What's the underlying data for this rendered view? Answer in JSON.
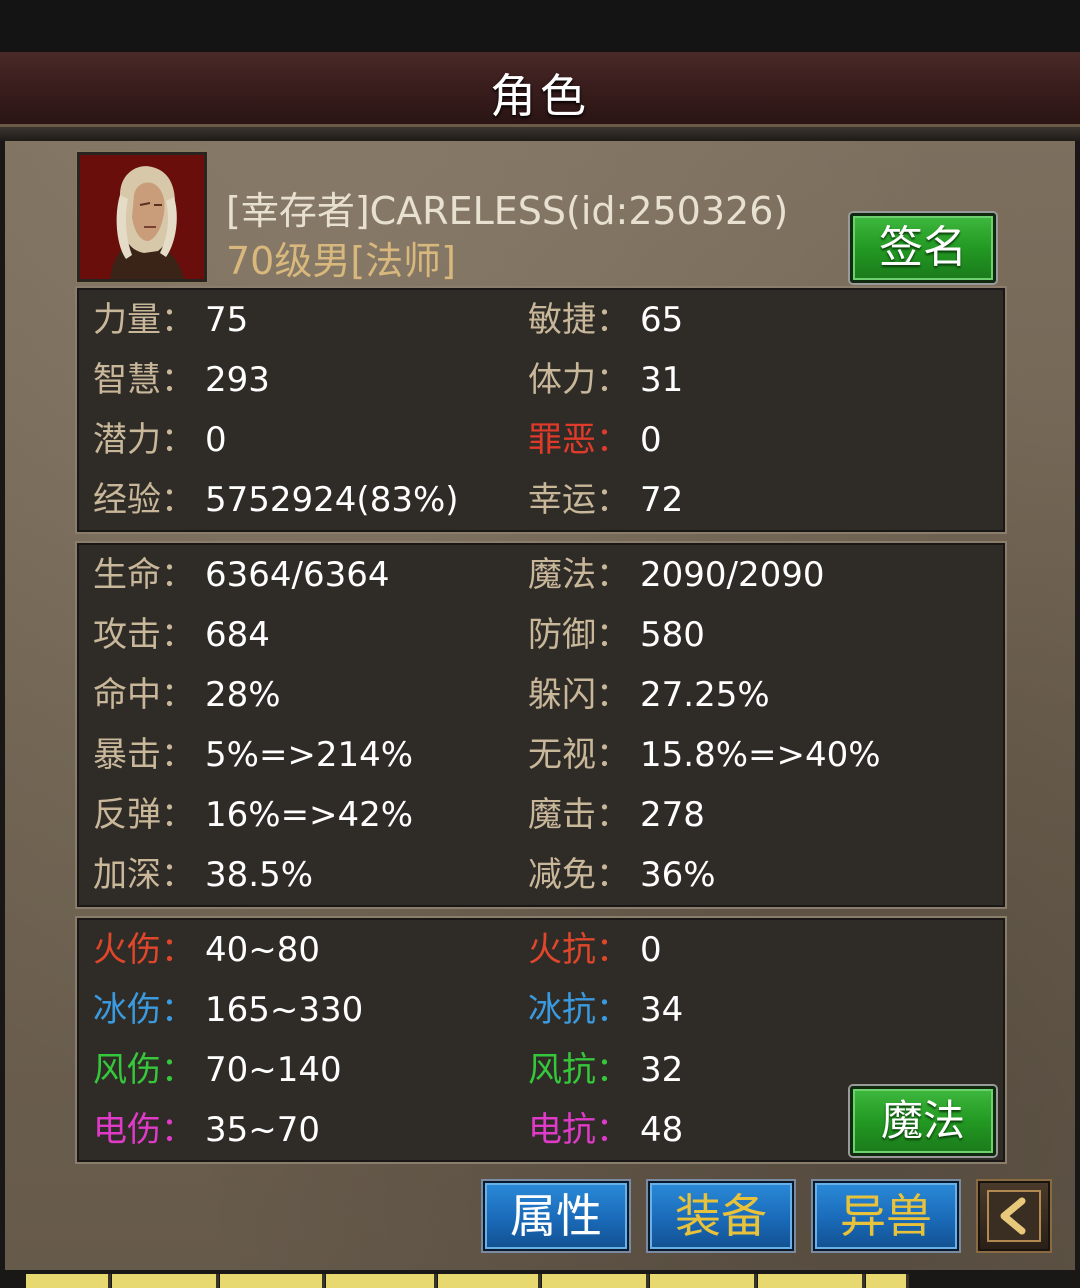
{
  "header": {
    "title": "角色"
  },
  "profile": {
    "name": "[幸存者]CARELESS(id:250326)",
    "level_class": "70级男[法师]",
    "sign_button": "签名"
  },
  "base_stats": [
    {
      "left": {
        "label": "力量",
        "value": "75"
      },
      "right": {
        "label": "敏捷",
        "value": "65"
      }
    },
    {
      "left": {
        "label": "智慧",
        "value": "293"
      },
      "right": {
        "label": "体力",
        "value": "31"
      }
    },
    {
      "left": {
        "label": "潜力",
        "value": "0"
      },
      "right": {
        "label": "罪恶",
        "value": "0"
      }
    },
    {
      "left": {
        "label": "经验",
        "value": "5752924(83%)"
      },
      "right": {
        "label": "幸运",
        "value": "72"
      }
    }
  ],
  "combat_stats": [
    {
      "left": {
        "label": "生命",
        "value": "6364/6364"
      },
      "right": {
        "label": "魔法",
        "value": "2090/2090"
      }
    },
    {
      "left": {
        "label": "攻击",
        "value": "684"
      },
      "right": {
        "label": "防御",
        "value": "580"
      }
    },
    {
      "left": {
        "label": "命中",
        "value": "28%"
      },
      "right": {
        "label": "躲闪",
        "value": "27.25%"
      }
    },
    {
      "left": {
        "label": "暴击",
        "value": "5%=>214%"
      },
      "right": {
        "label": "无视",
        "value": "15.8%=>40%"
      }
    },
    {
      "left": {
        "label": "反弹",
        "value": "16%=>42%"
      },
      "right": {
        "label": "魔击",
        "value": "278"
      }
    },
    {
      "left": {
        "label": "加深",
        "value": "38.5%"
      },
      "right": {
        "label": "减免",
        "value": "36%"
      }
    }
  ],
  "element_stats": [
    {
      "left": {
        "label": "火伤",
        "value": "40~80"
      },
      "right": {
        "label": "火抗",
        "value": "0"
      }
    },
    {
      "left": {
        "label": "冰伤",
        "value": "165~330"
      },
      "right": {
        "label": "冰抗",
        "value": "34"
      }
    },
    {
      "left": {
        "label": "风伤",
        "value": "70~140"
      },
      "right": {
        "label": "风抗",
        "value": "32"
      }
    },
    {
      "left": {
        "label": "电伤",
        "value": "35~70"
      },
      "right": {
        "label": "电抗",
        "value": "48"
      }
    }
  ],
  "colon": "：",
  "magic_button": "魔法",
  "tabs": {
    "attributes": "属性",
    "equipment": "装备",
    "beast": "异兽"
  },
  "icons": {
    "back": "chevron-left-icon",
    "avatar": "character-portrait"
  },
  "colors": {
    "label": "#c9b79a",
    "sin": "#e03a2a",
    "fire": "#e0462a",
    "ice": "#3a9ae0",
    "wind": "#34c83a",
    "electric": "#e03ac8",
    "button_green": "#239a23",
    "button_blue": "#1a6ab8",
    "tab_gold": "#e8c23a"
  }
}
